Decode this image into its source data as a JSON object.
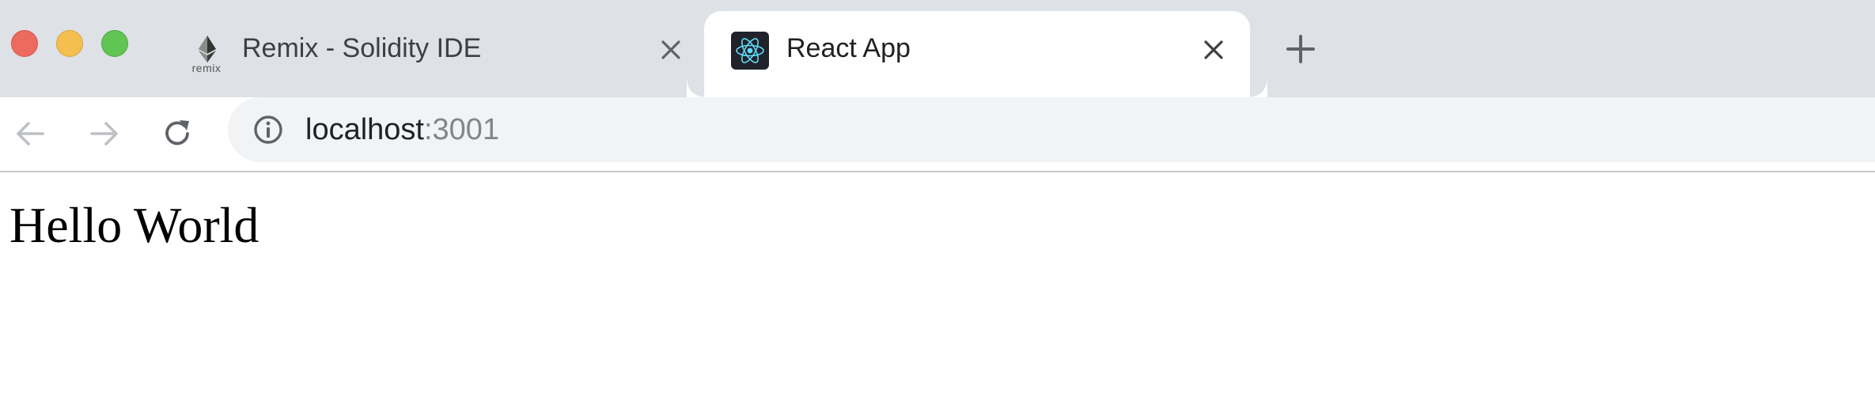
{
  "window": {
    "traffic_lights": [
      "close",
      "minimize",
      "maximize"
    ],
    "colors": {
      "close": "#ec6a5e",
      "minimize": "#f4bf4f",
      "maximize": "#61c554"
    }
  },
  "tabs": [
    {
      "title": "Remix - Solidity IDE",
      "favicon": "ethereum-icon",
      "favicon_caption": "remix",
      "active": false
    },
    {
      "title": "React App",
      "favicon": "react-icon",
      "active": true
    }
  ],
  "toolbar": {
    "back_icon": "arrow-left-icon",
    "forward_icon": "arrow-right-icon",
    "reload_icon": "reload-icon",
    "new_tab_icon": "plus-icon"
  },
  "address_bar": {
    "info_icon": "info-icon",
    "host": "localhost",
    "port": ":3001"
  },
  "page": {
    "heading": "Hello World"
  }
}
